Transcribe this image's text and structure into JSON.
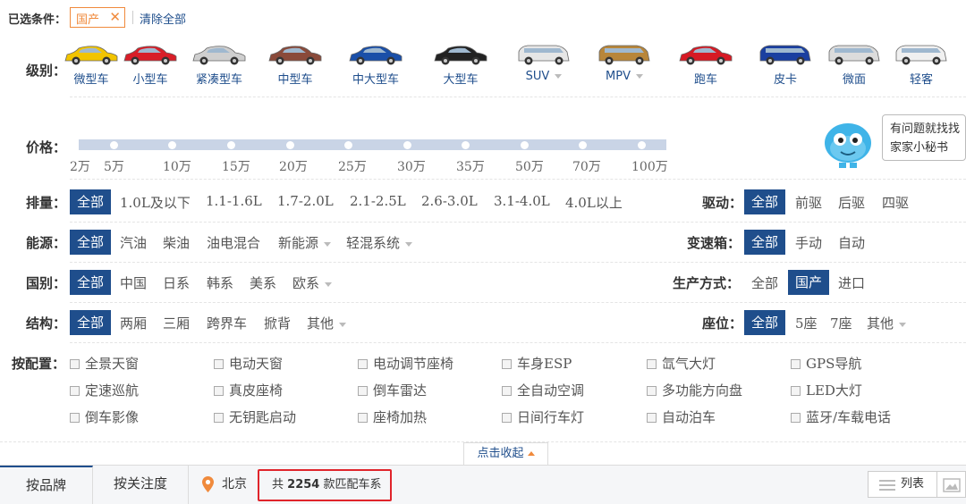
{
  "selected": {
    "label": "已选条件：",
    "tag": "国产",
    "clear": "清除全部"
  },
  "level": {
    "label": "级别：",
    "items": [
      {
        "name": "微型车",
        "color": "#f2c400"
      },
      {
        "name": "小型车",
        "color": "#d81e28"
      },
      {
        "name": "紧凑型车",
        "color": "#cfcfcf"
      },
      {
        "name": "中型车",
        "color": "#8a4a3a"
      },
      {
        "name": "中大型车",
        "color": "#1a4fa8"
      },
      {
        "name": "大型车",
        "color": "#222222"
      },
      {
        "name": "SUV",
        "color": "#e6e6e6",
        "more": true
      },
      {
        "name": "MPV",
        "color": "#b8863a",
        "more": true
      },
      {
        "name": "跑车",
        "color": "#d61a24"
      },
      {
        "name": "皮卡",
        "color": "#1a3fa0"
      },
      {
        "name": "微面",
        "color": "#dcdcdc"
      },
      {
        "name": "轻客",
        "color": "#f0f0f0"
      }
    ]
  },
  "price": {
    "label": "价格：",
    "ticks": [
      "2万",
      "5万",
      "10万",
      "15万",
      "20万",
      "25万",
      "30万",
      "35万",
      "50万",
      "70万",
      "100万"
    ]
  },
  "helper": {
    "text": "有问题就找找家家小秘书"
  },
  "displacement": {
    "label": "排量：",
    "options": [
      "全部",
      "1.0L及以下",
      "1.1-1.6L",
      "1.7-2.0L",
      "2.1-2.5L",
      "2.6-3.0L",
      "3.1-4.0L",
      "4.0L以上"
    ]
  },
  "drive": {
    "label": "驱动：",
    "options": [
      "全部",
      "前驱",
      "后驱",
      "四驱"
    ]
  },
  "energy": {
    "label": "能源：",
    "options": [
      "全部",
      "汽油",
      "柴油",
      "油电混合",
      "新能源",
      "轻混系统"
    ]
  },
  "gearbox": {
    "label": "变速箱：",
    "options": [
      "全部",
      "手动",
      "自动"
    ]
  },
  "country": {
    "label": "国别：",
    "options": [
      "全部",
      "中国",
      "日系",
      "韩系",
      "美系",
      "欧系"
    ]
  },
  "production": {
    "label": "生产方式：",
    "options": [
      "全部",
      "国产",
      "进口"
    ]
  },
  "structure": {
    "label": "结构：",
    "options": [
      "全部",
      "两厢",
      "三厢",
      "跨界车",
      "掀背",
      "其他"
    ]
  },
  "seats": {
    "label": "座位：",
    "options": [
      "全部",
      "5座",
      "7座",
      "其他"
    ]
  },
  "config": {
    "label": "按配置：",
    "items": [
      "全景天窗",
      "电动天窗",
      "电动调节座椅",
      "车身ESP",
      "氙气大灯",
      "GPS导航",
      "定速巡航",
      "真皮座椅",
      "倒车雷达",
      "全自动空调",
      "多功能方向盘",
      "LED大灯",
      "倒车影像",
      "无钥匙启动",
      "座椅加热",
      "日间行车灯",
      "自动泊车",
      "蓝牙/车载电话"
    ]
  },
  "collapse": "点击收起",
  "bottom": {
    "tab_brand": "按品牌",
    "tab_attention": "按关注度",
    "city": "北京",
    "count_prefix": "共",
    "count": "2254",
    "count_suffix": "款匹配车系",
    "list": "列表"
  },
  "colors": {
    "accent": "#1f4e8c",
    "tag": "#f08a3c",
    "highlight": "#e0242b"
  }
}
